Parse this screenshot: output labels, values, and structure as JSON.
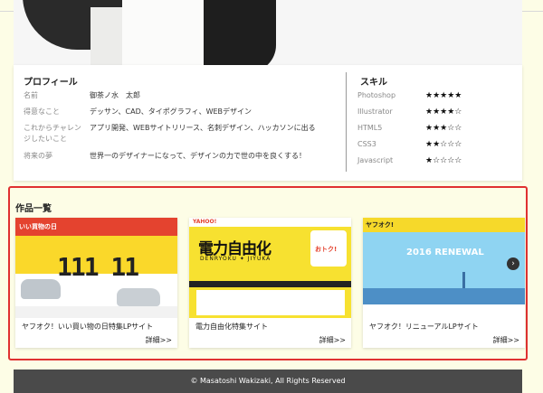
{
  "profile": {
    "title": "プロフィール",
    "rows": [
      {
        "key": "名前",
        "value": "御茶ノ水　太郎"
      },
      {
        "key": "得意なこと",
        "value": "デッサン、CAD、タイポグラフィ、WEBデザイン"
      },
      {
        "key": "これからチャレンジしたいこと",
        "value": "アプリ開発、WEBサイトリリース、名刺デザイン、ハッカソンに出る"
      },
      {
        "key": "将来の夢",
        "value": "世界一のデザイナーになって、デザインの力で世の中を良くする！"
      }
    ]
  },
  "skills": {
    "title": "スキル",
    "rows": [
      {
        "name": "Photoshop",
        "stars": "★★★★★",
        "level": 5
      },
      {
        "name": "Illustrator",
        "stars": "★★★★☆",
        "level": 4
      },
      {
        "name": "HTML5",
        "stars": "★★★☆☆",
        "level": 3
      },
      {
        "name": "CSS3",
        "stars": "★★☆☆☆",
        "level": 2
      },
      {
        "name": "Javascript",
        "stars": "★☆☆☆☆",
        "level": 1
      }
    ]
  },
  "works": {
    "title": "作品一覧",
    "items": [
      {
        "caption": "ヤフオク！いい買い物の日特集LPサイト",
        "more": "詳細>>",
        "thumb_logo": "いい買物の日",
        "thumb_big": "111 11"
      },
      {
        "caption": "電力自由化特集サイト",
        "more": "詳細>>",
        "thumb_logo": "YAHOO!",
        "thumb_title": "電力自由化",
        "thumb_sub": "DENRYOKU ✦ JIYUKA",
        "thumb_badge": "おトク!"
      },
      {
        "caption": "ヤフオク！リニューアルLPサイト",
        "more": "詳細>>",
        "thumb_logo": "ヤフオク!",
        "thumb_title": "2016 RENEWAL"
      }
    ],
    "next_arrow": "›"
  },
  "footer": {
    "copyright": "© Masatoshi Wakizaki, All Rights Reserved"
  },
  "colors": {
    "background": "#fdfde6",
    "highlight_border": "#e03131",
    "footer_bg": "#4a4a4a"
  }
}
